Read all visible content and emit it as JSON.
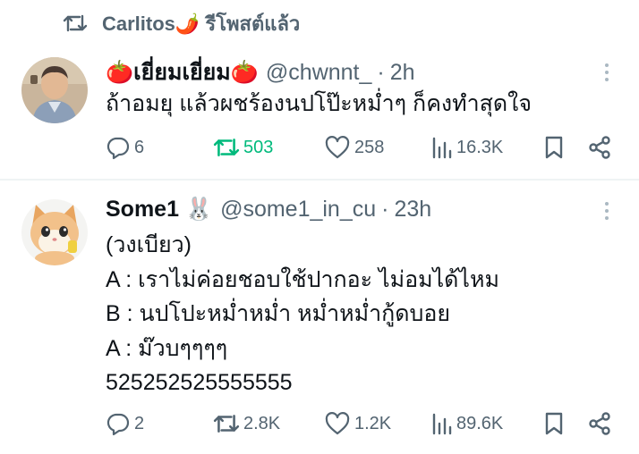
{
  "repost_banner": {
    "text": "Carlitos🌶️ รีโพสต์แล้ว"
  },
  "tweets": [
    {
      "display_name": "🍅เยี่ยมเยี่ยม🍅",
      "handle": "@chwnnt_",
      "separator": "·",
      "time": "2h",
      "lines": [
        "ถ้าอมยุ แล้วผชร้องนปโป๊ะหม่ำๆ ก็คงทำสุดใจ"
      ],
      "replies": "6",
      "reposts": "503",
      "likes": "258",
      "views": "16.3K",
      "reposted_by_me": true
    },
    {
      "display_name": "Some1 🐰",
      "handle": "@some1_in_cu",
      "separator": "·",
      "time": "23h",
      "lines": [
        "(วงเบียว)",
        "A : เราไม่ค่อยชอบใช้ปากอะ ไม่อมได้ไหม",
        "B : นปโปะหม่ำหม่ำ หม่ำหม่ำกู้ดบอย",
        "A : ม๊วบๆๆๆๆ",
        "525252525555555"
      ],
      "replies": "2",
      "reposts": "2.8K",
      "likes": "1.2K",
      "views": "89.6K",
      "reposted_by_me": false
    }
  ],
  "colors": {
    "text_primary": "#0f1419",
    "text_secondary": "#536471",
    "repost_active": "#00ba7c",
    "divider": "#eff3f4"
  }
}
